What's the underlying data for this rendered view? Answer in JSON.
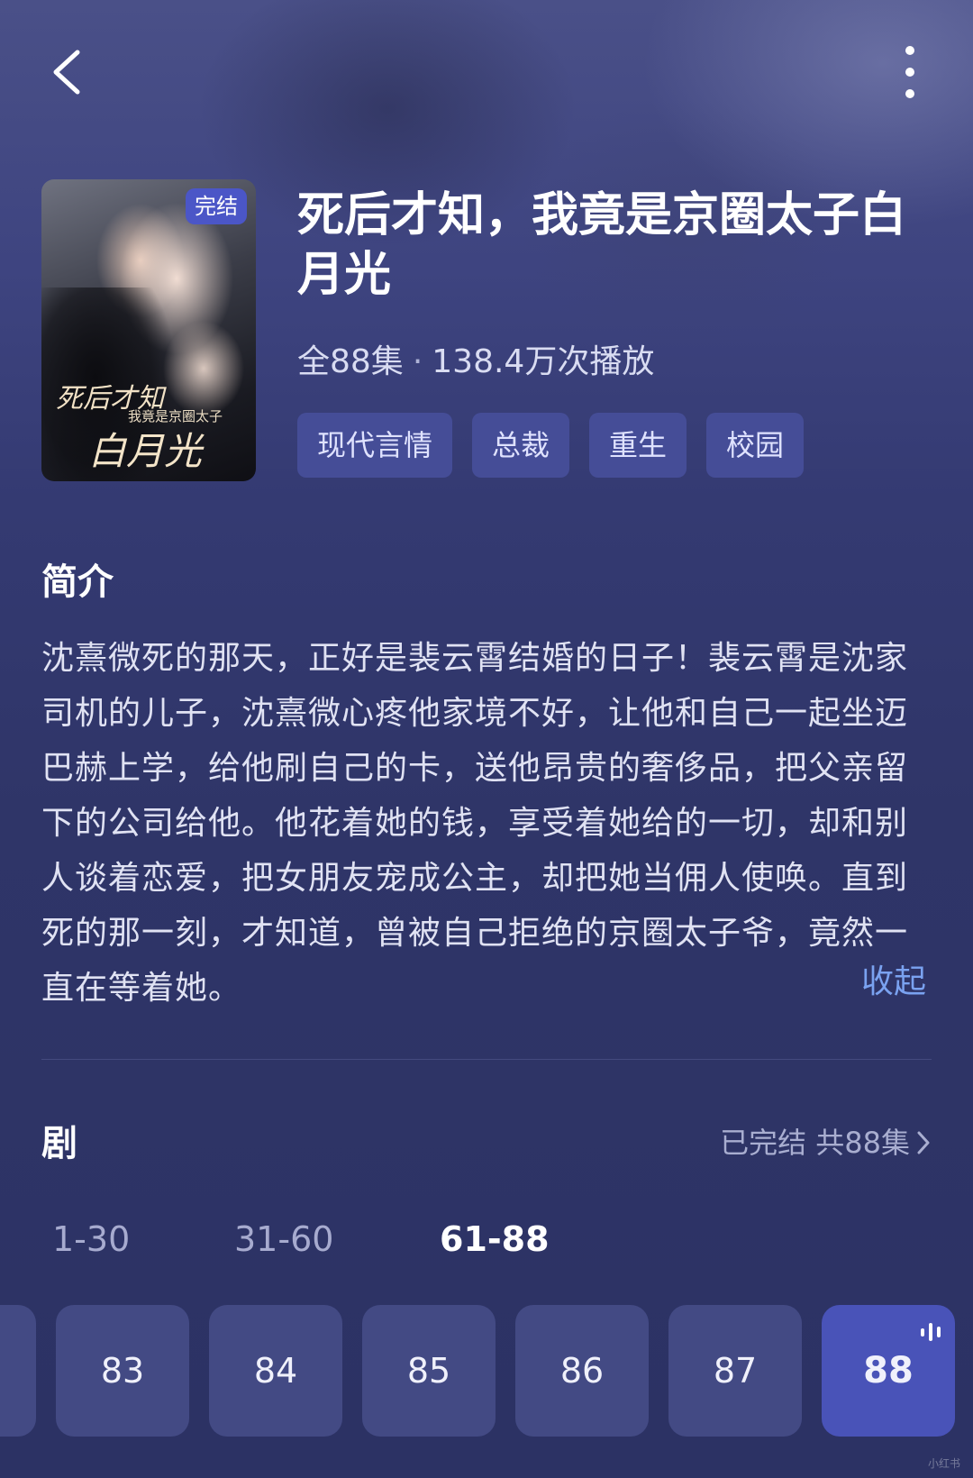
{
  "header": {
    "back_icon": "chevron-left-icon",
    "more_icon": "more-vertical-icon"
  },
  "drama": {
    "poster": {
      "badge": "完结",
      "art_title_line1": "死后才知",
      "art_title_line2": "我竟是京圈太子",
      "art_title_line3": "白月光"
    },
    "title": "死后才知，我竟是京圈太子白月光",
    "episodes_total": "全88集",
    "plays": "138.4万次播放",
    "tags": [
      "现代言情",
      "总裁",
      "重生",
      "校园"
    ]
  },
  "synopsis": {
    "heading": "简介",
    "text": "沈熹微死的那天，正好是裴云霄结婚的日子！裴云霄是沈家司机的儿子，沈熹微心疼他家境不好，让他和自己一起坐迈巴赫上学，给他刷自己的卡，送他昂贵的奢侈品，把父亲留下的公司给他。他花着她的钱，享受着她给的一切，却和别人谈着恋爱，把女朋友宠成公主，却把她当佣人使唤。直到死的那一刻，才知道，曾被自己拒绝的京圈太子爷，竟然一直在等着她。",
    "collapse_label": "收起"
  },
  "episodes_section": {
    "heading": "剧",
    "summary": "已完结 共88集",
    "summary_icon": "chevron-right-icon",
    "ranges": [
      "1-30",
      "31-60",
      "61-88"
    ],
    "active_range": "61-88",
    "episodes": [
      "83",
      "84",
      "85",
      "86",
      "87",
      "88"
    ],
    "active_episode": "88",
    "playing_icon": "sound-wave-icon"
  },
  "colors": {
    "background": "#2e3466",
    "tag_bg": "#454d97",
    "badge_bg": "#4b56c7",
    "accent_link": "#7aa2f0",
    "active_episode_bg": "#4953b8"
  },
  "watermark": "小红书"
}
